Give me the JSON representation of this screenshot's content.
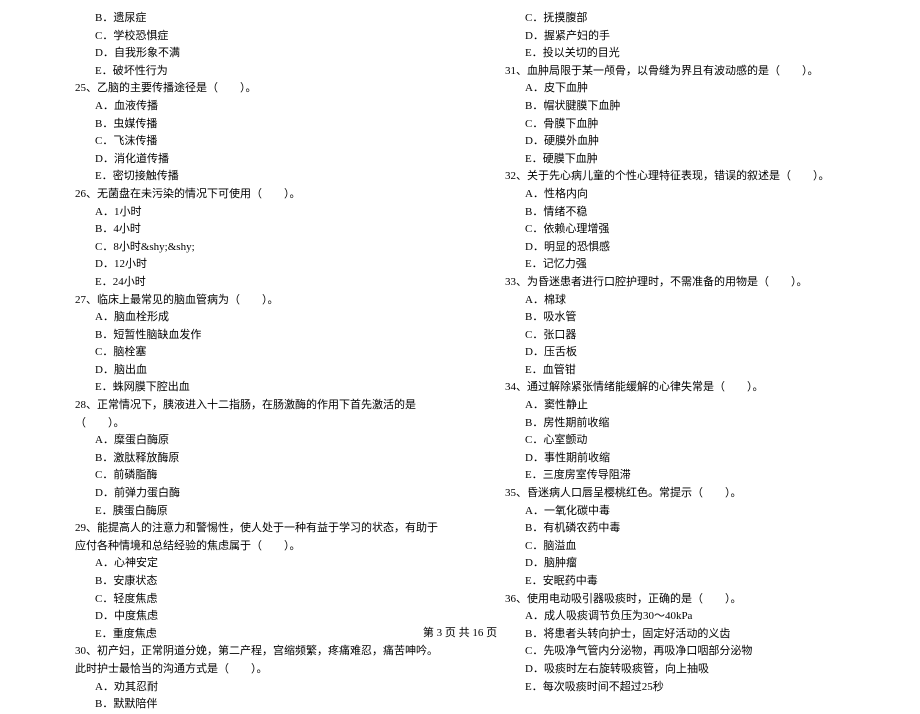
{
  "left_column": {
    "q24_options": [
      "B．遗尿症",
      "C．学校恐惧症",
      "D．自我形象不满",
      "E．破坏性行为"
    ],
    "q25": "25、乙脑的主要传播途径是（　　）。",
    "q25_options": [
      "A．血液传播",
      "B．虫媒传播",
      "C．飞沫传播",
      "D．消化道传播",
      "E．密切接触传播"
    ],
    "q26": "26、无菌盘在未污染的情况下可使用（　　）。",
    "q26_options": [
      "A．1小时",
      "B．4小时",
      "C．8小时&shy;&shy;",
      "D．12小时",
      "E．24小时"
    ],
    "q27": "27、临床上最常见的脑血管病为（　　）。",
    "q27_options": [
      "A．脑血栓形成",
      "B．短暂性脑缺血发作",
      "C．脑栓塞",
      "D．脑出血",
      "E．蛛网膜下腔出血"
    ],
    "q28": "28、正常情况下，胰液进入十二指肠，在肠激酶的作用下首先激活的是（　　）。",
    "q28_options": [
      "A．糜蛋白酶原",
      "B．激肽释放酶原",
      "C．前磷脂酶",
      "D．前弹力蛋白酶",
      "E．胰蛋白酶原"
    ],
    "q29": "29、能提高人的注意力和警惕性，使人处于一种有益于学习的状态，有助于应付各种情境和总结经验的焦虑属于（　　）。",
    "q29_options": [
      "A．心神安定",
      "B．安康状态",
      "C．轻度焦虑",
      "D．中度焦虑",
      "E．重度焦虑"
    ],
    "q30": "30、初产妇，正常阴道分娩，第二产程，宫缩频繁，疼痛难忍，痛苦呻吟。此时护士最恰当的沟通方式是（　　）。",
    "q30_options": [
      "A．劝其忍耐",
      "B．默默陪伴"
    ]
  },
  "right_column": {
    "q30_continued": [
      "C．抚摸腹部",
      "D．握紧产妇的手",
      "E．投以关切的目光"
    ],
    "q31": "31、血肿局限于某一颅骨，以骨缝为界且有波动感的是（　　）。",
    "q31_options": [
      "A．皮下血肿",
      "B．帽状腱膜下血肿",
      "C．骨膜下血肿",
      "D．硬膜外血肿",
      "E．硬膜下血肿"
    ],
    "q32": "32、关于先心病儿童的个性心理特征表现，错误的叙述是（　　）。",
    "q32_options": [
      "A．性格内向",
      "B．情绪不稳",
      "C．依赖心理增强",
      "D．明显的恐惧感",
      "E．记忆力强"
    ],
    "q33": "33、为昏迷患者进行口腔护理时，不需准备的用物是（　　）。",
    "q33_options": [
      "A．棉球",
      "B．吸水管",
      "C．张口器",
      "D．压舌板",
      "E．血管钳"
    ],
    "q34": "34、通过解除紧张情绪能缓解的心律失常是（　　）。",
    "q34_options": [
      "A．窦性静止",
      "B．房性期前收缩",
      "C．心室颤动",
      "D．事性期前收缩",
      "E．三度房室传导阻滞"
    ],
    "q35": "35、昏迷病人口唇呈樱桃红色。常提示（　　）。",
    "q35_options": [
      "A．一氧化碳中毒",
      "B．有机磷农药中毒",
      "C．脑溢血",
      "D．脑肿瘤",
      "E．安眠药中毒"
    ],
    "q36": "36、使用电动吸引器吸痰时，正确的是（　　）。",
    "q36_options": [
      "A．成人吸痰调节负压为30～40kPa",
      "B．将患者头转向护士，固定好活动的义齿",
      "C．先吸净气管内分泌物，再吸净口咽部分泌物",
      "D．吸痰时左右旋转吸痰管，向上抽吸",
      "E．每次吸痰时间不超过25秒"
    ]
  },
  "footer": "第 3 页 共 16 页"
}
